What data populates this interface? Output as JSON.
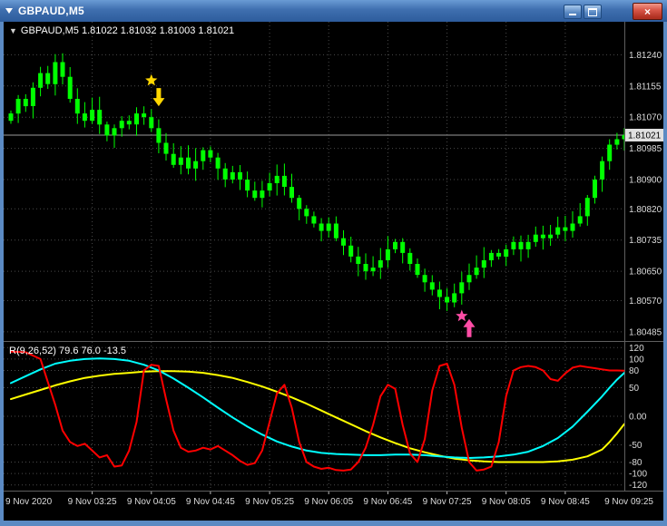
{
  "window": {
    "title": "GBPAUD,M5",
    "controls": {
      "close": "×"
    }
  },
  "icons": {
    "one_click_arrow": "▼"
  },
  "main_panel": {
    "ohlc_label": "GBPAUD,M5  1.81022 1.81032 1.81003 1.81021",
    "price_badge": "1.81021"
  },
  "indicator_panel": {
    "label": "R(9,26,52) 79.6 76.0 -13.5"
  },
  "colors": {
    "candle": "#00FF00",
    "grid": "#4a4a4a",
    "bid_line": "#9a9a9a",
    "badge_bg": "#e0e0e0",
    "axis_text": "#dcdcdc",
    "gold_marker": "#FFD700",
    "pink_marker": "#FF4DA6"
  },
  "chart_data": [
    {
      "type": "candlestick",
      "title": "GBPAUD M5",
      "ylim": [
        1.8046,
        1.8133
      ],
      "y_ticks": [
        1.8124,
        1.81155,
        1.8107,
        1.80985,
        1.809,
        1.8082,
        1.80735,
        1.8065,
        1.8057,
        1.80485
      ],
      "x_labels": [
        {
          "i": 0,
          "label": "9 Nov 2020"
        },
        {
          "i": 11,
          "label": "9 Nov 03:25"
        },
        {
          "i": 19,
          "label": "9 Nov 04:05"
        },
        {
          "i": 27,
          "label": "9 Nov 04:45"
        },
        {
          "i": 35,
          "label": "9 Nov 05:25"
        },
        {
          "i": 43,
          "label": "9 Nov 06:05"
        },
        {
          "i": 51,
          "label": "9 Nov 06:45"
        },
        {
          "i": 59,
          "label": "9 Nov 07:25"
        },
        {
          "i": 67,
          "label": "9 Nov 08:05"
        },
        {
          "i": 75,
          "label": "9 Nov 08:45"
        },
        {
          "i": 83,
          "label": "9 Nov 09:25"
        }
      ],
      "current_price": 1.81021,
      "closes": [
        1.8108,
        1.8112,
        1.811,
        1.8115,
        1.8119,
        1.8116,
        1.8122,
        1.8118,
        1.8112,
        1.8108,
        1.8106,
        1.8109,
        1.8105,
        1.8102,
        1.8104,
        1.8106,
        1.8105,
        1.8108,
        1.8107,
        1.8104,
        1.81,
        1.8097,
        1.8094,
        1.8096,
        1.8093,
        1.8095,
        1.8098,
        1.8096,
        1.8093,
        1.809,
        1.8092,
        1.809,
        1.8087,
        1.8085,
        1.8087,
        1.8089,
        1.8091,
        1.8088,
        1.8085,
        1.8082,
        1.808,
        1.8078,
        1.8076,
        1.8078,
        1.8074,
        1.8072,
        1.8069,
        1.8067,
        1.8065,
        1.8066,
        1.8068,
        1.8071,
        1.8073,
        1.807,
        1.8067,
        1.8064,
        1.8062,
        1.806,
        1.8058,
        1.80565,
        1.8059,
        1.8062,
        1.8064,
        1.8066,
        1.8068,
        1.807,
        1.8069,
        1.8071,
        1.8073,
        1.8071,
        1.8073,
        1.8075,
        1.8074,
        1.8075,
        1.8077,
        1.8076,
        1.8078,
        1.808,
        1.8085,
        1.809,
        1.8095,
        1.80995,
        1.8101,
        1.81021
      ],
      "markers": [
        {
          "shape": "star",
          "color": "#FFD700",
          "i": 19,
          "price": 1.8117
        },
        {
          "shape": "arrow-down",
          "color": "#FFD700",
          "i": 20,
          "price": 1.811
        },
        {
          "shape": "star",
          "color": "#FF4DA6",
          "i": 61,
          "price": 1.80528
        },
        {
          "shape": "arrow-up",
          "color": "#FF4DA6",
          "i": 62,
          "price": 1.8052
        }
      ]
    },
    {
      "type": "line",
      "title": "R(9,26,52)",
      "ylim": [
        -130,
        130
      ],
      "y_ticks": [
        {
          "v": 120,
          "label": "120"
        },
        {
          "v": 100,
          "label": "100"
        },
        {
          "v": 80,
          "label": "80"
        },
        {
          "v": 50,
          "label": "50"
        },
        {
          "v": 0,
          "label": "0.00"
        },
        {
          "v": -50,
          "label": "-50"
        },
        {
          "v": -80,
          "label": "-80"
        },
        {
          "v": -100,
          "label": "-100"
        },
        {
          "v": -120,
          "label": "-120"
        }
      ],
      "series": [
        {
          "name": "yellow",
          "color": "#FFFF00",
          "last_value": -13.5,
          "points": [
            [
              0,
              30
            ],
            [
              2,
              38
            ],
            [
              4,
              46
            ],
            [
              6,
              54
            ],
            [
              8,
              61
            ],
            [
              10,
              67
            ],
            [
              12,
              71
            ],
            [
              14,
              74
            ],
            [
              16,
              76
            ],
            [
              18,
              78
            ],
            [
              20,
              79
            ],
            [
              22,
              79
            ],
            [
              24,
              78
            ],
            [
              26,
              76
            ],
            [
              28,
              72
            ],
            [
              30,
              67
            ],
            [
              32,
              60
            ],
            [
              34,
              52
            ],
            [
              36,
              43
            ],
            [
              38,
              33
            ],
            [
              40,
              22
            ],
            [
              42,
              10
            ],
            [
              44,
              -2
            ],
            [
              46,
              -14
            ],
            [
              48,
              -26
            ],
            [
              50,
              -37
            ],
            [
              52,
              -47
            ],
            [
              54,
              -56
            ],
            [
              56,
              -63
            ],
            [
              58,
              -69
            ],
            [
              60,
              -74
            ],
            [
              62,
              -77
            ],
            [
              64,
              -79
            ],
            [
              66,
              -80
            ],
            [
              68,
              -80
            ],
            [
              70,
              -80
            ],
            [
              72,
              -80
            ],
            [
              74,
              -79
            ],
            [
              76,
              -76
            ],
            [
              78,
              -70
            ],
            [
              80,
              -58
            ],
            [
              81,
              -45
            ],
            [
              82,
              -30
            ],
            [
              83,
              -13.5
            ]
          ]
        },
        {
          "name": "cyan",
          "color": "#00FFFF",
          "last_value": 76.0,
          "points": [
            [
              0,
              58
            ],
            [
              2,
              70
            ],
            [
              4,
              82
            ],
            [
              6,
              92
            ],
            [
              8,
              97
            ],
            [
              10,
              100
            ],
            [
              12,
              101
            ],
            [
              14,
              100
            ],
            [
              16,
              97
            ],
            [
              18,
              90
            ],
            [
              20,
              80
            ],
            [
              22,
              66
            ],
            [
              24,
              50
            ],
            [
              26,
              33
            ],
            [
              28,
              15
            ],
            [
              30,
              -2
            ],
            [
              32,
              -18
            ],
            [
              34,
              -32
            ],
            [
              36,
              -44
            ],
            [
              38,
              -53
            ],
            [
              40,
              -60
            ],
            [
              42,
              -64
            ],
            [
              44,
              -66
            ],
            [
              46,
              -67
            ],
            [
              48,
              -68
            ],
            [
              50,
              -68
            ],
            [
              52,
              -67
            ],
            [
              54,
              -67
            ],
            [
              56,
              -68
            ],
            [
              58,
              -70
            ],
            [
              60,
              -72
            ],
            [
              62,
              -73
            ],
            [
              64,
              -72
            ],
            [
              66,
              -70
            ],
            [
              68,
              -67
            ],
            [
              70,
              -62
            ],
            [
              72,
              -52
            ],
            [
              74,
              -38
            ],
            [
              76,
              -18
            ],
            [
              78,
              8
            ],
            [
              80,
              35
            ],
            [
              81,
              50
            ],
            [
              82,
              64
            ],
            [
              83,
              76
            ]
          ]
        },
        {
          "name": "red",
          "color": "#FF0000",
          "last_value": 79.6,
          "points": [
            [
              0,
              113
            ],
            [
              2,
              112
            ],
            [
              4,
              100
            ],
            [
              5,
              60
            ],
            [
              6,
              20
            ],
            [
              7,
              -25
            ],
            [
              8,
              -45
            ],
            [
              9,
              -52
            ],
            [
              10,
              -48
            ],
            [
              11,
              -60
            ],
            [
              12,
              -72
            ],
            [
              13,
              -68
            ],
            [
              14,
              -88
            ],
            [
              15,
              -86
            ],
            [
              16,
              -60
            ],
            [
              17,
              -10
            ],
            [
              18,
              80
            ],
            [
              19,
              90
            ],
            [
              20,
              88
            ],
            [
              21,
              30
            ],
            [
              22,
              -25
            ],
            [
              23,
              -55
            ],
            [
              24,
              -62
            ],
            [
              25,
              -60
            ],
            [
              26,
              -55
            ],
            [
              27,
              -58
            ],
            [
              28,
              -52
            ],
            [
              29,
              -60
            ],
            [
              30,
              -68
            ],
            [
              31,
              -78
            ],
            [
              32,
              -85
            ],
            [
              33,
              -82
            ],
            [
              34,
              -60
            ],
            [
              35,
              -10
            ],
            [
              36,
              40
            ],
            [
              37,
              55
            ],
            [
              38,
              15
            ],
            [
              39,
              -45
            ],
            [
              40,
              -80
            ],
            [
              41,
              -88
            ],
            [
              42,
              -92
            ],
            [
              43,
              -90
            ],
            [
              44,
              -94
            ],
            [
              45,
              -95
            ],
            [
              46,
              -93
            ],
            [
              47,
              -80
            ],
            [
              48,
              -55
            ],
            [
              49,
              -15
            ],
            [
              50,
              35
            ],
            [
              51,
              55
            ],
            [
              52,
              48
            ],
            [
              53,
              -15
            ],
            [
              54,
              -65
            ],
            [
              55,
              -80
            ],
            [
              56,
              -40
            ],
            [
              57,
              45
            ],
            [
              58,
              88
            ],
            [
              59,
              92
            ],
            [
              60,
              55
            ],
            [
              61,
              -20
            ],
            [
              62,
              -80
            ],
            [
              63,
              -95
            ],
            [
              64,
              -93
            ],
            [
              65,
              -88
            ],
            [
              66,
              -45
            ],
            [
              67,
              35
            ],
            [
              68,
              80
            ],
            [
              69,
              86
            ],
            [
              70,
              88
            ],
            [
              71,
              86
            ],
            [
              72,
              80
            ],
            [
              73,
              65
            ],
            [
              74,
              62
            ],
            [
              75,
              75
            ],
            [
              76,
              85
            ],
            [
              77,
              88
            ],
            [
              78,
              86
            ],
            [
              79,
              84
            ],
            [
              80,
              82
            ],
            [
              81,
              80
            ],
            [
              82,
              80
            ],
            [
              83,
              79.6
            ]
          ]
        }
      ]
    }
  ]
}
